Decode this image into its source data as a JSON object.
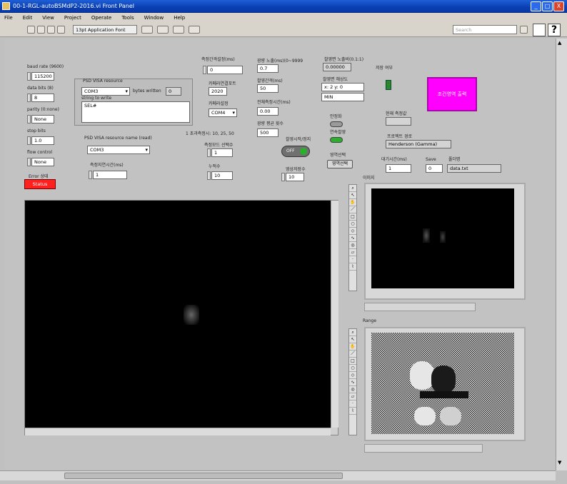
{
  "window": {
    "title": "00-1-RGL-autoBSMdP2-2016.vi Front Panel",
    "min": "_",
    "max": "□",
    "close": "X"
  },
  "menu": [
    "File",
    "Edit",
    "View",
    "Project",
    "Operate",
    "Tools",
    "Window",
    "Help"
  ],
  "toolbar": {
    "font": "13pt Application Font",
    "search": "Search",
    "help": "?"
  },
  "left": {
    "baud": {
      "label": "baud rate (9600)",
      "value": "115200"
    },
    "databits": {
      "label": "data bits (8)",
      "value": "8"
    },
    "parity": {
      "label": "parity (0:none)",
      "value": "None"
    },
    "stopbits": {
      "label": "stop bits",
      "value": "1.0"
    },
    "flow": {
      "label": "flow control",
      "value": "None"
    },
    "error": {
      "label": "Error 상태",
      "value": "Status"
    }
  },
  "visa_write": {
    "label": "PSD VISA resource",
    "port": "COM3",
    "bytes_label": "bytes written",
    "bytes": "0",
    "string_label": "string to write",
    "string": "SEL#"
  },
  "visa_read": {
    "label": "PSD VISA resource name (read)",
    "port": "COM3"
  },
  "read_delay": {
    "label": "측정지연시간(ms)",
    "value": "1"
  },
  "center": {
    "c1": {
      "label": "측정간격설정(ms)",
      "value": "0"
    },
    "c2": {
      "label": "카메라연결포트",
      "value": "2020"
    },
    "c3": {
      "label": "카메라설정",
      "value": "COM4"
    },
    "note": "1 초과측정시: 10, 25, 50",
    "c4": {
      "label": "측정모드 선택수",
      "value": "1"
    },
    "c5": {
      "label": "누적수",
      "value": "10"
    }
  },
  "col2": {
    "d1": {
      "label": "광량 노출(ms)(0~9999",
      "value": "0.7"
    },
    "d2": {
      "label": "촬영간격(ms)",
      "value": "50"
    },
    "d3": {
      "label": "전체측정시간(ms)",
      "value": "0.00"
    },
    "d4": {
      "label": "광량 평균 횟수",
      "value": "500"
    },
    "toggle_label": "촬영시작/정지",
    "toggle": "OFF",
    "d5": {
      "label": "영상저장수",
      "value": "10"
    }
  },
  "col3": {
    "e1": {
      "label": "촬영면 노출비(0.1:1)",
      "value": "0.00000"
    },
    "e2": {
      "label": "촬영면 해상도",
      "value": "x: 2 y: 0"
    },
    "e3": {
      "value": "MIN"
    },
    "led_label": "저장 여부",
    "sw1": "안정화",
    "sw2": "연속촬영",
    "sw3_label": "영역선택",
    "sw3": "영역선택",
    "pink": "조건영역 출력"
  },
  "col4": {
    "f1": {
      "label": "현재 측정값",
      "value": ""
    },
    "f2": {
      "label": "프로젝트 경로",
      "value": "Henderson (Gamma)"
    },
    "f3": {
      "label": "대기시간(ms)",
      "value": "1"
    },
    "f4": {
      "label": "Save",
      "value": "0"
    },
    "f5": {
      "label": "폴더명",
      "value": "data.txt"
    }
  },
  "graphs": {
    "main": "",
    "g1": "이미지",
    "g2": "Range"
  },
  "colors": {
    "accent": "#ff00ff",
    "alarm": "#ff2020",
    "led": "#2a8a2a",
    "title": "#0a3fb3"
  }
}
